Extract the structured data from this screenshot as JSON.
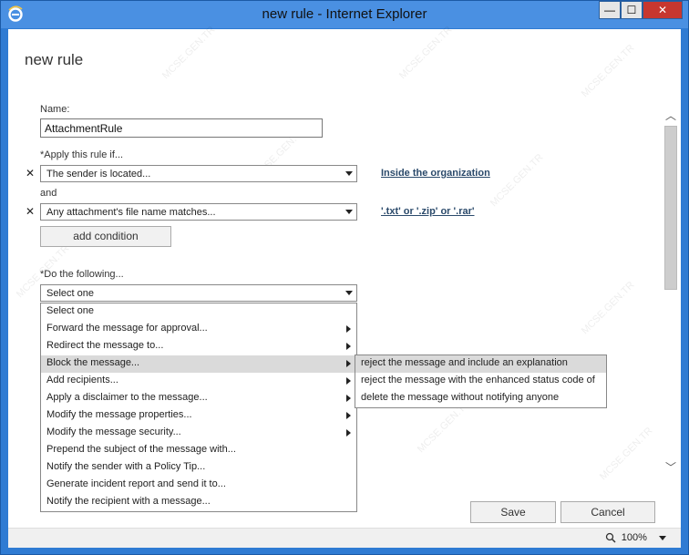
{
  "window": {
    "title": "new rule - Internet Explorer",
    "minimize_label": "—",
    "maximize_label": "☐",
    "close_label": "✕"
  },
  "page": {
    "title": "new rule"
  },
  "form": {
    "name_label": "Name:",
    "name_value": "AttachmentRule",
    "apply_label": "*Apply this rule if...",
    "conditions": [
      {
        "remove": "✕",
        "value": "The sender is located...",
        "link": "Inside the organization"
      },
      {
        "remove": "✕",
        "value": "Any attachment's file name matches...",
        "link": "'.txt' or '.zip' or '.rar'"
      }
    ],
    "and_label": "and",
    "add_condition_label": "add condition",
    "do_label": "*Do the following...",
    "action_select_value": "Select one"
  },
  "action_menu": {
    "items": [
      {
        "label": "Select one",
        "submenu": false
      },
      {
        "label": "Forward the message for approval...",
        "submenu": true
      },
      {
        "label": "Redirect the message to...",
        "submenu": true
      },
      {
        "label": "Block the message...",
        "submenu": true,
        "highlighted": true
      },
      {
        "label": "Add recipients...",
        "submenu": true
      },
      {
        "label": "Apply a disclaimer to the message...",
        "submenu": true
      },
      {
        "label": "Modify the message properties...",
        "submenu": true
      },
      {
        "label": "Modify the message security...",
        "submenu": true
      },
      {
        "label": "Prepend the subject of the message with...",
        "submenu": false
      },
      {
        "label": "Notify the sender with a Policy Tip...",
        "submenu": false
      },
      {
        "label": "Generate incident report and send it to...",
        "submenu": false
      },
      {
        "label": "Notify the recipient with a message...",
        "submenu": false
      }
    ]
  },
  "block_submenu": {
    "items": [
      {
        "label": "reject the message and include an explanation",
        "highlighted": true
      },
      {
        "label": "reject the message with the enhanced status code of",
        "highlighted": false
      },
      {
        "label": "delete the message without notifying anyone",
        "highlighted": false
      }
    ]
  },
  "buttons": {
    "save": "Save",
    "cancel": "Cancel"
  },
  "statusbar": {
    "zoom": "100%"
  },
  "watermark": "MCSE.GEN.TR",
  "colors": {
    "titlebar": "#4a90e2",
    "window_border": "#2f7bd3",
    "link": "#2b4a6b",
    "highlight": "#dadada"
  }
}
